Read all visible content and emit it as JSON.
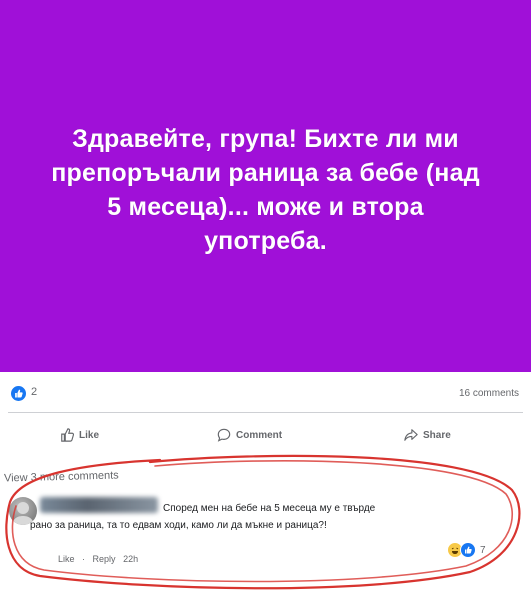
{
  "post": {
    "text": "Здравейте, група! Бихте ли ми препоръчали раница за бебе (над 5 месеца)... може и втора употреба."
  },
  "stats": {
    "reactions_count": "2",
    "comments_count": "16 comments"
  },
  "actions": {
    "like_label": "Like",
    "comment_label": "Comment",
    "share_label": "Share"
  },
  "comments": {
    "view_more": "View 3 more comments",
    "items": [
      {
        "text_line1": "Според мен на бебе на 5 месеца му е твърде",
        "text_line2": "рано за раница, та то едвам ходи, камо ли да мъкне и раница?!",
        "like_label": "Like",
        "reply_label": "Reply",
        "time": "22h",
        "reaction_count": "7"
      }
    ]
  },
  "colors": {
    "banner": "#a010d8",
    "accent": "#1877f2",
    "annotation_ink": "#d8342f"
  }
}
